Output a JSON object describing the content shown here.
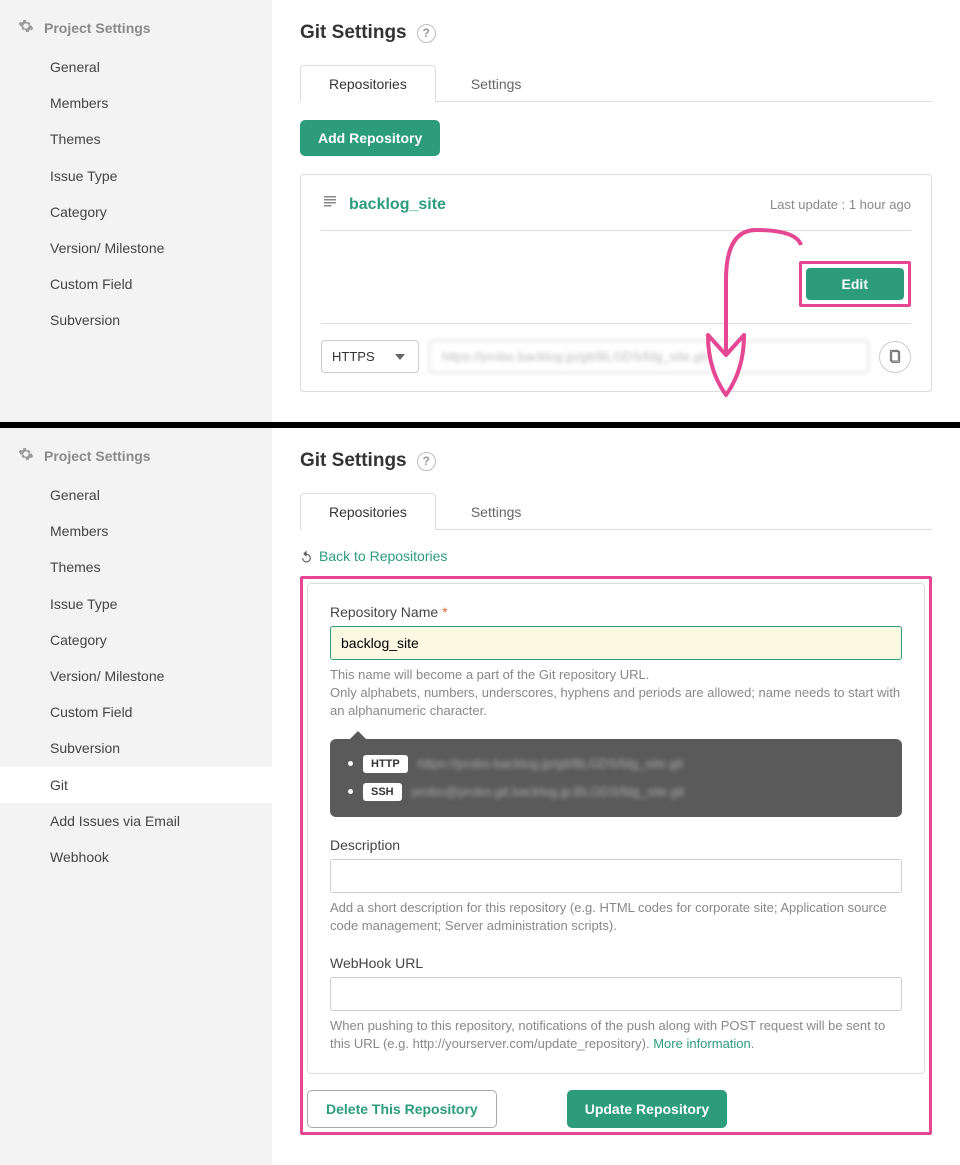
{
  "sidebar": {
    "title": "Project Settings",
    "items": [
      {
        "label": "General"
      },
      {
        "label": "Members"
      },
      {
        "label": "Themes"
      },
      {
        "label": "Issue Type"
      },
      {
        "label": "Category"
      },
      {
        "label": "Version/ Milestone"
      },
      {
        "label": "Custom Field"
      },
      {
        "label": "Subversion"
      },
      {
        "label": "Git"
      },
      {
        "label": "Add Issues via Email"
      },
      {
        "label": "Webhook"
      }
    ]
  },
  "page": {
    "title": "Git Settings"
  },
  "tabs": {
    "repositories": "Repositories",
    "settings": "Settings"
  },
  "buttons": {
    "add_repo": "Add Repository",
    "edit": "Edit",
    "delete_repo": "Delete This Repository",
    "update_repo": "Update Repository"
  },
  "repo": {
    "name": "backlog_site",
    "last_update": "Last update : 1 hour ago",
    "protocol": "HTTPS",
    "url_blur": "https://probo.backlog.jp/git/BLGDS/blg_site.git"
  },
  "back_link": "Back to Repositories",
  "form": {
    "name_label": "Repository Name",
    "name_value": "backlog_site",
    "name_help1": "This name will become a part of the Git repository URL.",
    "name_help2": "Only alphabets, numbers, underscores, hyphens and periods are allowed; name needs to start with an alphanumeric character.",
    "http_badge": "HTTP",
    "ssh_badge": "SSH",
    "http_url": "https://probo.backlog.jp/git/BLGDS/blg_site.git",
    "ssh_url": "probo@probo.git.backlog.jp:BLGDS/blg_site.git",
    "desc_label": "Description",
    "desc_help": "Add a short description for this repository (e.g. HTML codes for corporate site; Application source code management; Server administration scripts).",
    "webhook_label": "WebHook URL",
    "webhook_help": "When pushing to this repository, notifications of the push along with POST request will be sent to this URL (e.g. http://yourserver.com/update_repository). ",
    "more_info": "More information"
  }
}
